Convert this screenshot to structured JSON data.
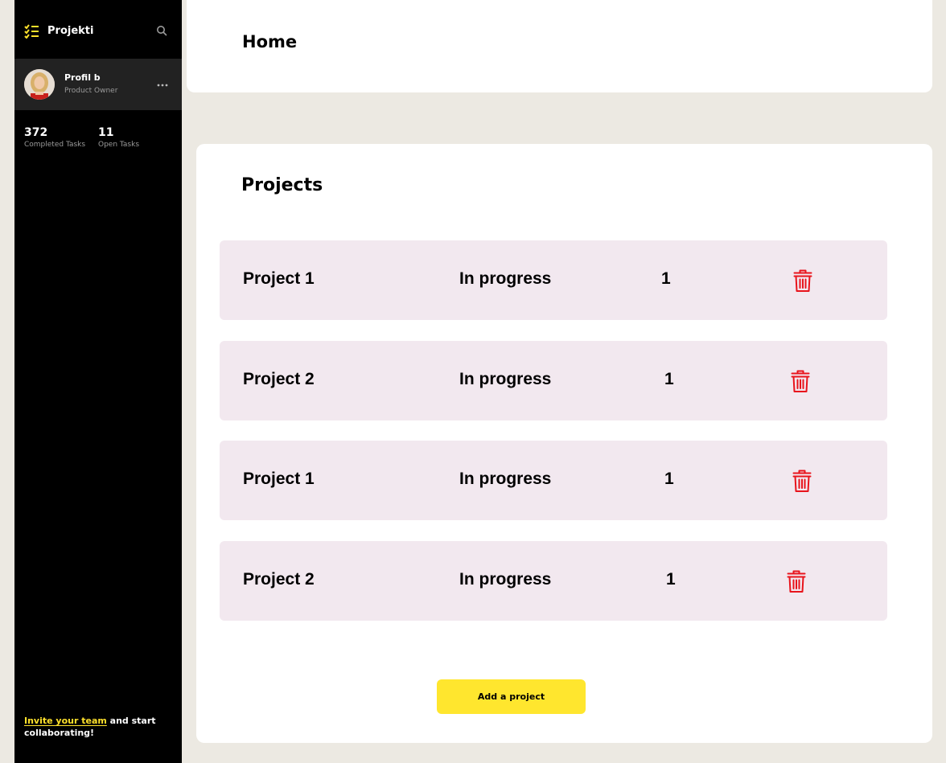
{
  "sidebar": {
    "brand": "Projekti",
    "profile": {
      "name": "Profil b",
      "role": "Product Owner"
    },
    "stats": [
      {
        "value": "372",
        "label": "Completed Tasks"
      },
      {
        "value": "11",
        "label": "Open Tasks"
      }
    ],
    "invite": {
      "link_text": "Invite your team",
      "rest_text": " and start collaborating!"
    }
  },
  "header": {
    "title": "Home"
  },
  "projects": {
    "title": "Projects",
    "items": [
      {
        "name": "Project 1",
        "status": "In progress",
        "count": "1"
      },
      {
        "name": "Project 2",
        "status": "In progress",
        "count": "1"
      },
      {
        "name": "Project 1",
        "status": "In progress",
        "count": "1"
      },
      {
        "name": "Project 2",
        "status": "In progress",
        "count": "1"
      }
    ],
    "add_label": "Add a project"
  },
  "colors": {
    "accent": "#ffe62e",
    "delete": "#e8141c",
    "row_bg": "#f2e8ef",
    "page_bg": "#ece9e2",
    "sidebar_bg": "#000000"
  }
}
